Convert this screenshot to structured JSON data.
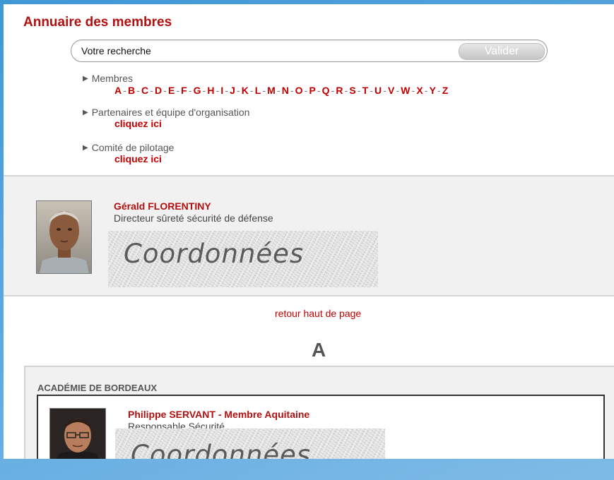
{
  "page": {
    "title": "Annuaire des membres"
  },
  "search": {
    "placeholder": "Votre recherche",
    "button_label": "Valider"
  },
  "nav": {
    "membres": {
      "label": "Membres",
      "letters": [
        "A",
        "B",
        "C",
        "D",
        "E",
        "F",
        "G",
        "H",
        "I",
        "J",
        "K",
        "L",
        "M",
        "N",
        "O",
        "P",
        "Q",
        "R",
        "S",
        "T",
        "U",
        "V",
        "W",
        "X",
        "Y",
        "Z"
      ]
    },
    "partenaires": {
      "label": "Partenaires et équipe d'organisation",
      "link": "cliquez ici"
    },
    "comite": {
      "label": "Comité de pilotage",
      "link": "cliquez ici"
    }
  },
  "featured": {
    "name": "Gérald FLORENTINY",
    "role": "Directeur sûreté sécurité de défense",
    "contact_label": "Coordonnées"
  },
  "back_to_top": "retour haut de page",
  "section_letter": "A",
  "groups": [
    {
      "title": "ACADÉMIE DE BORDEAUX",
      "member": {
        "name": "Philippe SERVANT - Membre Aquitaine",
        "role": "Responsable Sécurité",
        "contact_label": "Coordonnées"
      }
    }
  ],
  "colors": {
    "accent": "#b01010",
    "link": "#c00000",
    "background": "#4a9fdc"
  }
}
